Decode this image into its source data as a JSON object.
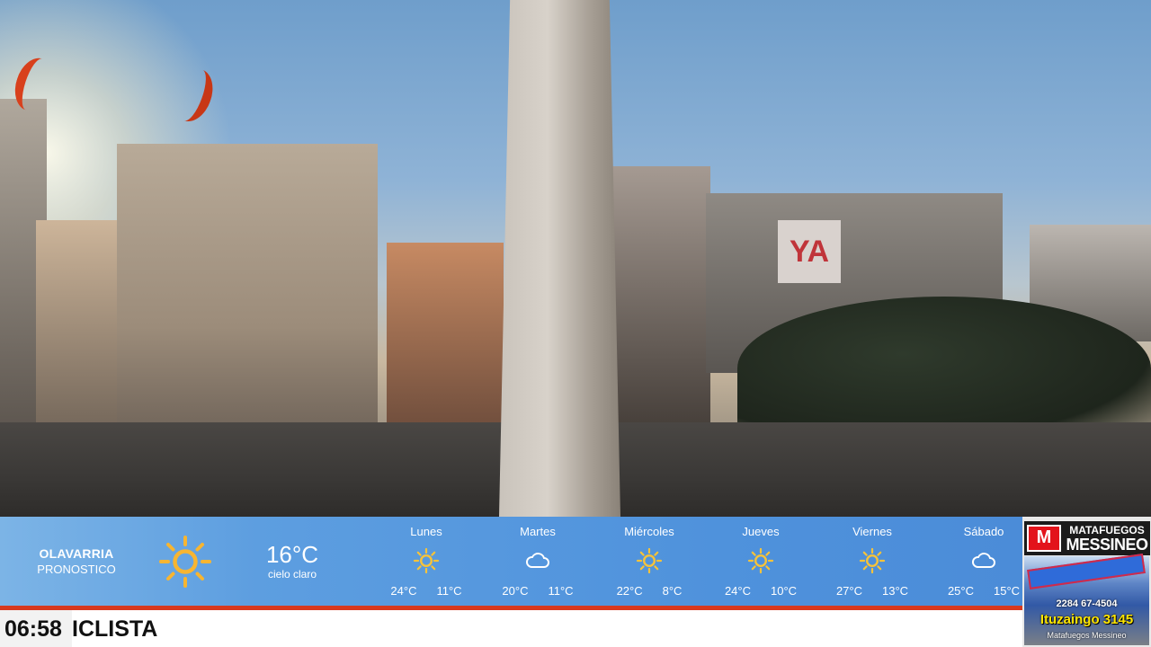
{
  "weather": {
    "location": "OLAVARRIA",
    "subtitle": "PRONOSTICO",
    "current": {
      "temp": "16°C",
      "condition": "cielo claro",
      "icon": "sun-icon"
    },
    "forecast": [
      {
        "day": "Lunes",
        "icon": "sun-icon",
        "max": "24°C",
        "min": "11°C"
      },
      {
        "day": "Martes",
        "icon": "cloud-icon",
        "max": "20°C",
        "min": "11°C"
      },
      {
        "day": "Miércoles",
        "icon": "sun-icon",
        "max": "22°C",
        "min": "8°C"
      },
      {
        "day": "Jueves",
        "icon": "sun-icon",
        "max": "24°C",
        "min": "10°C"
      },
      {
        "day": "Viernes",
        "icon": "sun-icon",
        "max": "27°C",
        "min": "13°C"
      },
      {
        "day": "Sábado",
        "icon": "cloud-icon",
        "max": "25°C",
        "min": "15°C"
      }
    ]
  },
  "ticker": {
    "clock": "06:58",
    "text": "ICLISTA"
  },
  "scene": {
    "sign_text": "YA"
  },
  "ad": {
    "logo": "M",
    "brand_top": "MATAFUEGOS",
    "brand_bottom": "MESSINEO",
    "phone": "2284 67-4504",
    "address": "Ituzaingo 3145",
    "social": "Matafuegos Messineo"
  },
  "colors": {
    "bar_blue": "#4f92dc",
    "accent_red": "#d8391e",
    "ad_address": "#ffe600"
  }
}
